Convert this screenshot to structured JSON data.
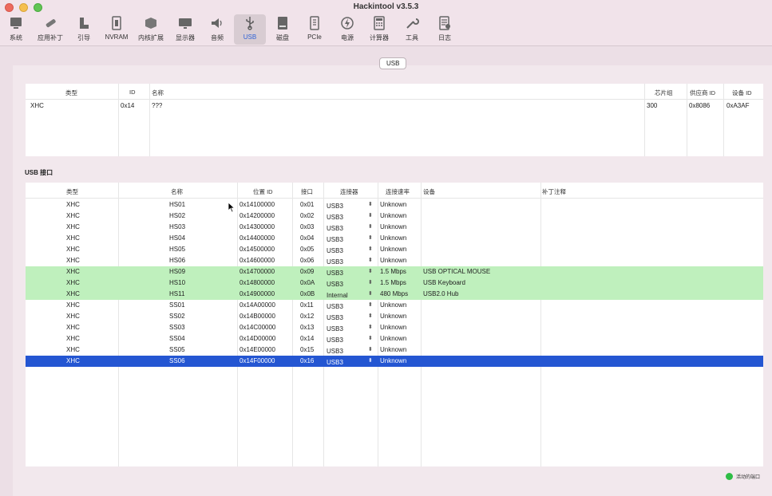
{
  "window": {
    "title": "Hackintool v3.5.3"
  },
  "toolbar": [
    {
      "label": "系统",
      "icon": "monitor-icon"
    },
    {
      "label": "应用补丁",
      "icon": "patch-icon"
    },
    {
      "label": "引导",
      "icon": "boot-icon"
    },
    {
      "label": "NVRAM",
      "icon": "nvram-icon"
    },
    {
      "label": "内核扩展",
      "icon": "kext-icon"
    },
    {
      "label": "显示器",
      "icon": "display-icon"
    },
    {
      "label": "音频",
      "icon": "speaker-icon"
    },
    {
      "label": "USB",
      "icon": "usb-icon",
      "active": true
    },
    {
      "label": "磁盘",
      "icon": "disk-icon"
    },
    {
      "label": "PCIe",
      "icon": "pcie-icon"
    },
    {
      "label": "电源",
      "icon": "power-icon"
    },
    {
      "label": "计算器",
      "icon": "calculator-icon"
    },
    {
      "label": "工具",
      "icon": "tools-icon"
    },
    {
      "label": "日志",
      "icon": "log-icon"
    }
  ],
  "usb_tab": "USB",
  "controllers": {
    "headers": [
      "类型",
      "ID",
      "名称",
      "芯片组",
      "供应商 ID",
      "设备 ID"
    ],
    "rows": [
      [
        "XHC",
        "0x14",
        "???",
        "300",
        "0x8086",
        "0xA3AF"
      ]
    ]
  },
  "ports_section_title": "USB 接口",
  "ports": {
    "headers": [
      "类型",
      "名称",
      "位置 ID",
      "接口",
      "连接器",
      "连接速率",
      "设备",
      "补丁注释"
    ],
    "rows": [
      {
        "type": "XHC",
        "name": "HS01",
        "loc": "0x14100000",
        "port": "0x01",
        "conn": "USB3",
        "speed": "Unknown",
        "device": "",
        "state": ""
      },
      {
        "type": "XHC",
        "name": "HS02",
        "loc": "0x14200000",
        "port": "0x02",
        "conn": "USB3",
        "speed": "Unknown",
        "device": "",
        "state": ""
      },
      {
        "type": "XHC",
        "name": "HS03",
        "loc": "0x14300000",
        "port": "0x03",
        "conn": "USB3",
        "speed": "Unknown",
        "device": "",
        "state": ""
      },
      {
        "type": "XHC",
        "name": "HS04",
        "loc": "0x14400000",
        "port": "0x04",
        "conn": "USB3",
        "speed": "Unknown",
        "device": "",
        "state": ""
      },
      {
        "type": "XHC",
        "name": "HS05",
        "loc": "0x14500000",
        "port": "0x05",
        "conn": "USB3",
        "speed": "Unknown",
        "device": "",
        "state": ""
      },
      {
        "type": "XHC",
        "name": "HS06",
        "loc": "0x14600000",
        "port": "0x06",
        "conn": "USB3",
        "speed": "Unknown",
        "device": "",
        "state": ""
      },
      {
        "type": "XHC",
        "name": "HS09",
        "loc": "0x14700000",
        "port": "0x09",
        "conn": "USB3",
        "speed": "1.5 Mbps",
        "device": "USB OPTICAL MOUSE",
        "state": "green"
      },
      {
        "type": "XHC",
        "name": "HS10",
        "loc": "0x14800000",
        "port": "0x0A",
        "conn": "USB3",
        "speed": "1.5 Mbps",
        "device": "USB Keyboard",
        "state": "green"
      },
      {
        "type": "XHC",
        "name": "HS11",
        "loc": "0x14900000",
        "port": "0x0B",
        "conn": "Internal",
        "speed": "480 Mbps",
        "device": "USB2.0 Hub",
        "state": "green"
      },
      {
        "type": "XHC",
        "name": "SS01",
        "loc": "0x14A00000",
        "port": "0x11",
        "conn": "USB3",
        "speed": "Unknown",
        "device": "",
        "state": ""
      },
      {
        "type": "XHC",
        "name": "SS02",
        "loc": "0x14B00000",
        "port": "0x12",
        "conn": "USB3",
        "speed": "Unknown",
        "device": "",
        "state": ""
      },
      {
        "type": "XHC",
        "name": "SS03",
        "loc": "0x14C00000",
        "port": "0x13",
        "conn": "USB3",
        "speed": "Unknown",
        "device": "",
        "state": ""
      },
      {
        "type": "XHC",
        "name": "SS04",
        "loc": "0x14D00000",
        "port": "0x14",
        "conn": "USB3",
        "speed": "Unknown",
        "device": "",
        "state": ""
      },
      {
        "type": "XHC",
        "name": "SS05",
        "loc": "0x14E00000",
        "port": "0x15",
        "conn": "USB3",
        "speed": "Unknown",
        "device": "",
        "state": ""
      },
      {
        "type": "XHC",
        "name": "SS06",
        "loc": "0x14F00000",
        "port": "0x16",
        "conn": "USB3",
        "speed": "Unknown",
        "device": "",
        "state": "selected"
      }
    ]
  },
  "legend": {
    "label": "活动的端口",
    "color": "#2fbd46"
  },
  "colors": {
    "active_row": "#bff0bd",
    "selected_row": "#2456d2",
    "accent": "#2f62d6"
  }
}
